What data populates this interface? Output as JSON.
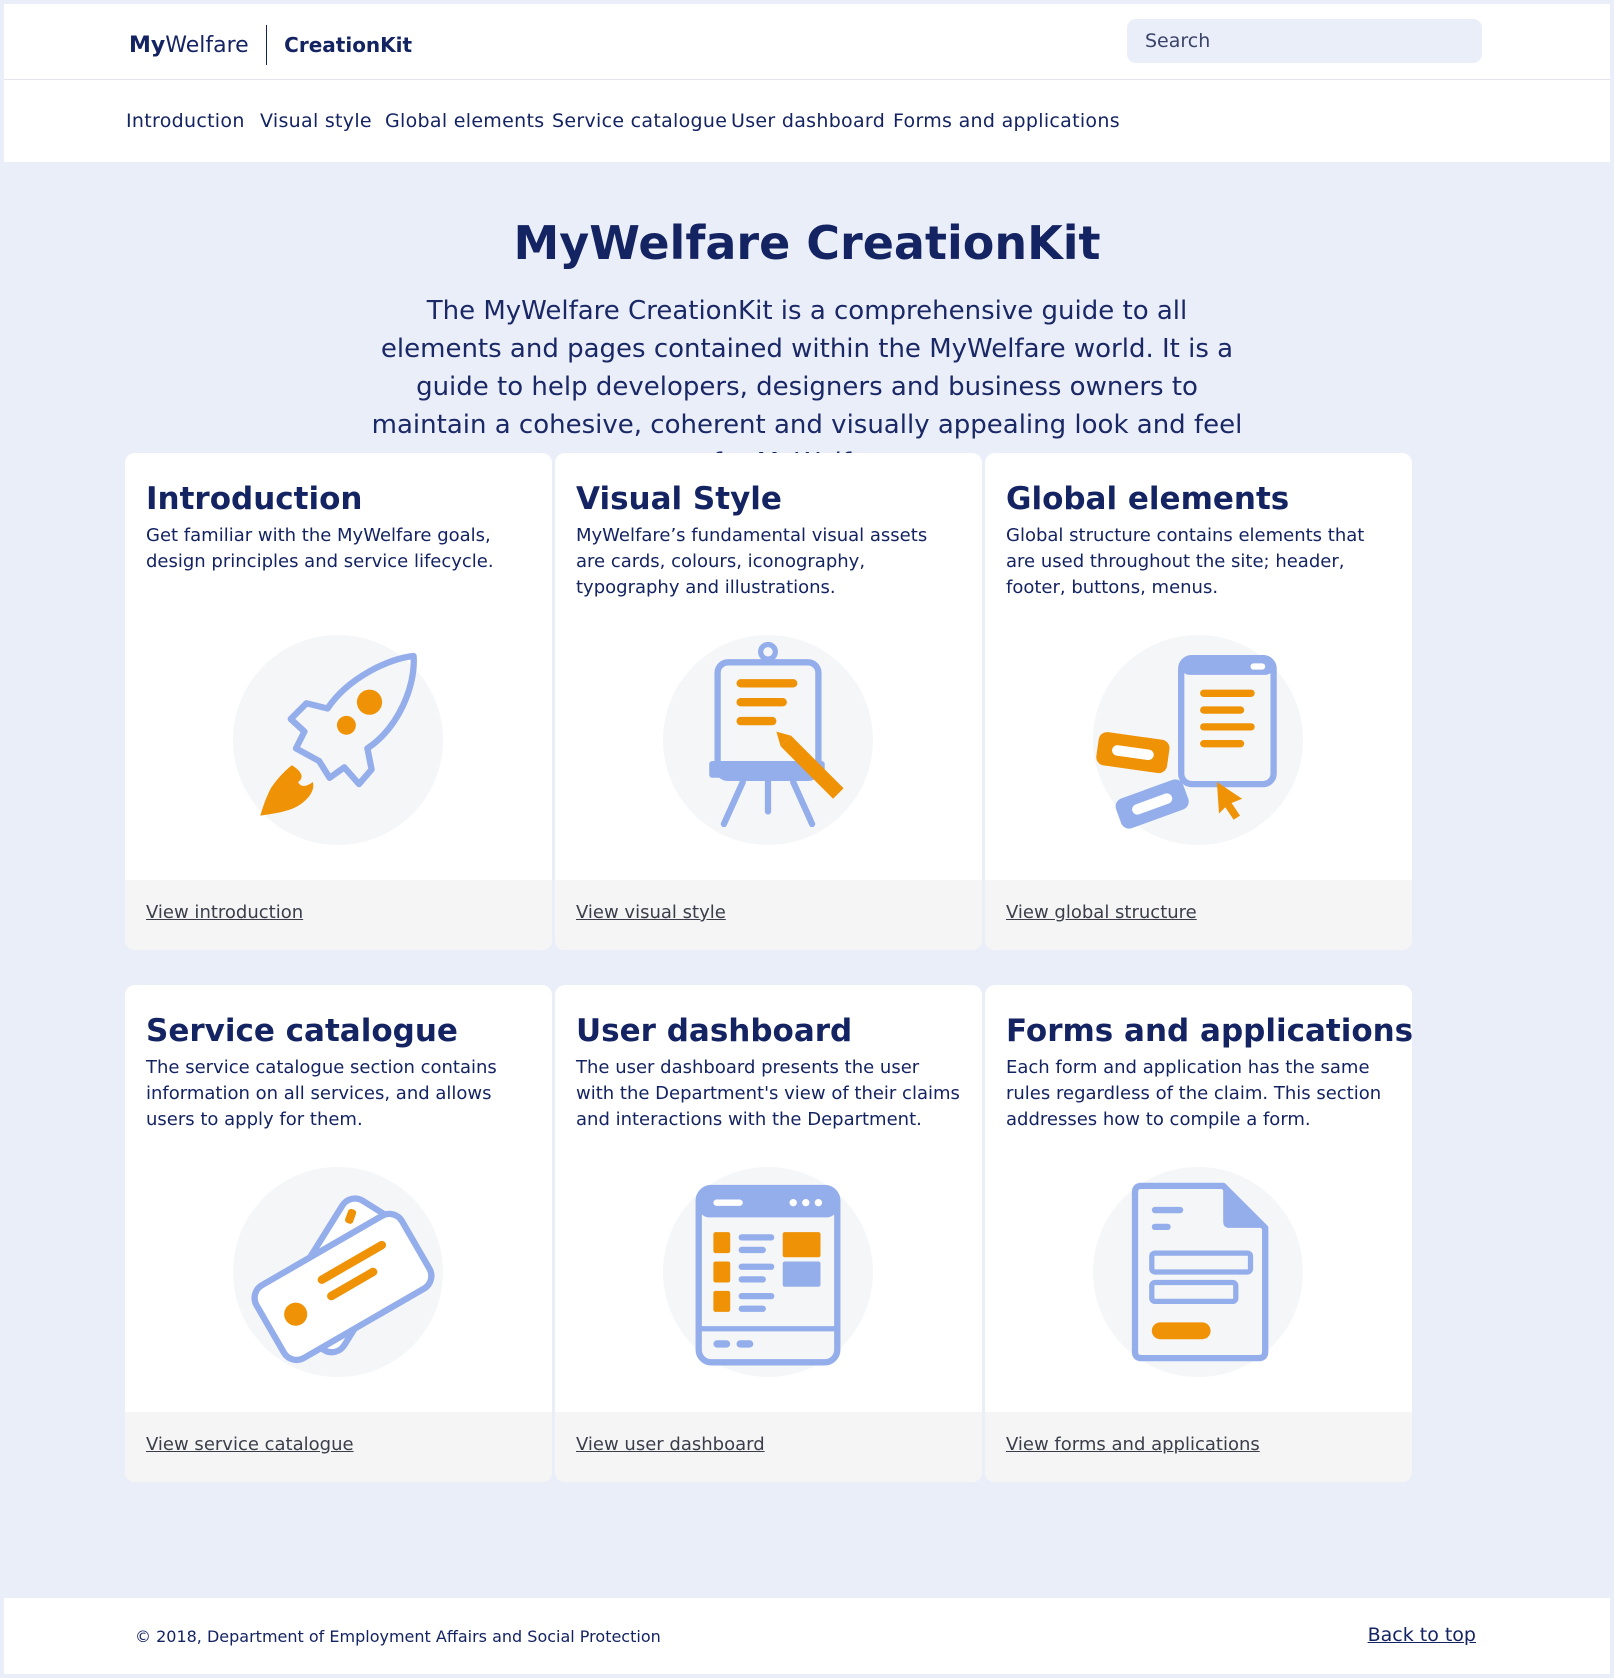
{
  "header": {
    "logo_bold": "My",
    "logo_regular": "Welfare",
    "product": "CreationKit",
    "search_placeholder": "Search"
  },
  "nav": {
    "items": [
      {
        "label": "Introduction"
      },
      {
        "label": "Visual style"
      },
      {
        "label": "Global elements"
      },
      {
        "label": "Service catalogue"
      },
      {
        "label": "User dashboard"
      },
      {
        "label": "Forms and applications"
      }
    ]
  },
  "hero": {
    "title": "MyWelfare CreationKit",
    "text": "The MyWelfare CreationKit is a comprehensive guide to all elements and pages contained within the MyWelfare world. It is a guide to help developers, designers and business owners to maintain a cohesive, coherent and visually appealing look and feel for MyWelfare."
  },
  "cards": [
    {
      "title": "Introduction",
      "desc": "Get familiar with the MyWelfare goals, design principles and service lifecycle.",
      "link": "View introduction",
      "icon": "rocket-icon"
    },
    {
      "title": "Visual Style",
      "desc": "MyWelfare’s fundamental visual assets are cards, colours, iconography, typography and illustrations.",
      "link": "View visual style",
      "icon": "easel-icon"
    },
    {
      "title": "Global elements",
      "desc": "Global structure contains elements that are used throughout the site; header, footer, buttons, menus.",
      "link": "View global structure",
      "icon": "ui-elements-icon"
    },
    {
      "title": "Service catalogue",
      "desc": "The service catalogue section contains information on all services, and allows users to apply for them.",
      "link": "View service catalogue",
      "icon": "tickets-icon"
    },
    {
      "title": "User dashboard",
      "desc": "The user dashboard presents the user with the Department's view of their claims and interactions with the Department.",
      "link": "View user dashboard",
      "icon": "dashboard-icon"
    },
    {
      "title": "Forms and applications",
      "desc": "Each form and application has the same rules regardless of the claim. This section addresses how to compile a form.",
      "link": "View forms and applications",
      "icon": "document-icon"
    }
  ],
  "footer": {
    "copyright": "© 2018, Department of Employment Affairs and Social Protection",
    "back_to_top": "Back to top"
  },
  "colors": {
    "navy": "#142362",
    "background": "#eaeef8",
    "icon_blue": "#94adeb",
    "icon_orange": "#ef9205",
    "card_footer": "#f5f5f5"
  }
}
